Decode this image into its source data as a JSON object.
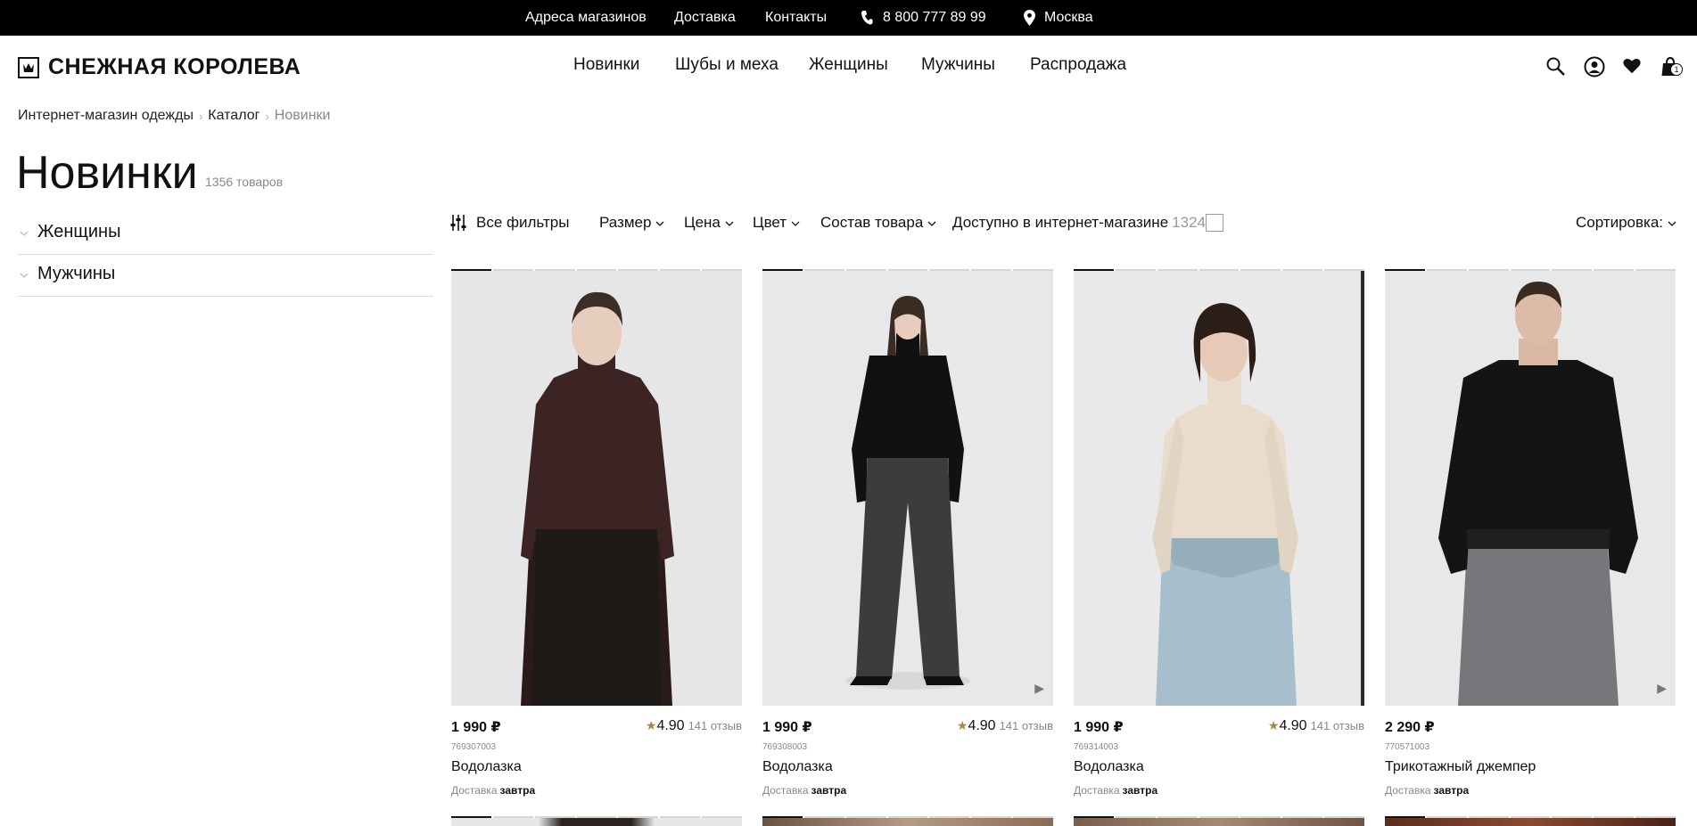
{
  "topbar": {
    "stores": "Адреса магазинов",
    "delivery": "Доставка",
    "contacts": "Контакты",
    "phone": "8 800 777 89 99",
    "city": "Москва"
  },
  "header": {
    "logo": "СНЕЖНАЯ КОРОЛЕВА",
    "nav": [
      "Новинки",
      "Шубы и меха",
      "Женщины",
      "Мужчины",
      "Распродажа"
    ],
    "cart_count": "1"
  },
  "breadcrumb": [
    "Интернет-магазин одежды",
    "Каталог",
    "Новинки"
  ],
  "page": {
    "title": "Новинки",
    "count": "1356 товаров"
  },
  "categories": [
    "Женщины",
    "Мужчины"
  ],
  "filters": {
    "all": "Все фильтры",
    "size": "Размер",
    "price": "Цена",
    "color": "Цвет",
    "composition": "Состав товара",
    "available": "Доступно в интернет-магазине",
    "available_count": "1324",
    "sort": "Сортировка:"
  },
  "products": [
    {
      "price": "1 990 ₽",
      "rating": "4.90",
      "reviews": "141 отзыв",
      "sku": "769307003",
      "name": "Водолазка",
      "delivery_label": "Доставка",
      "delivery_value": "завтра",
      "has_video": false
    },
    {
      "price": "1 990 ₽",
      "rating": "4.90",
      "reviews": "141 отзыв",
      "sku": "769308003",
      "name": "Водолазка",
      "delivery_label": "Доставка",
      "delivery_value": "завтра",
      "has_video": true
    },
    {
      "price": "1 990 ₽",
      "rating": "4.90",
      "reviews": "141 отзыв",
      "sku": "769314003",
      "name": "Водолазка",
      "delivery_label": "Доставка",
      "delivery_value": "завтра",
      "has_video": false
    },
    {
      "price": "2 290 ₽",
      "rating": "",
      "reviews": "",
      "sku": "770571003",
      "name": "Трикотажный джемпер",
      "delivery_label": "Доставка",
      "delivery_value": "завтра",
      "has_video": true
    }
  ],
  "colors": {
    "topbar_bg": "#000000",
    "star": "#a8864a",
    "text": "#111111",
    "muted": "#888888"
  },
  "icons": [
    "phone-icon",
    "location-pin-icon",
    "crown-logo-icon",
    "search-icon",
    "user-icon",
    "heart-icon",
    "cart-icon",
    "chevron-down-icon",
    "filter-sliders-icon",
    "star-icon",
    "play-icon"
  ]
}
